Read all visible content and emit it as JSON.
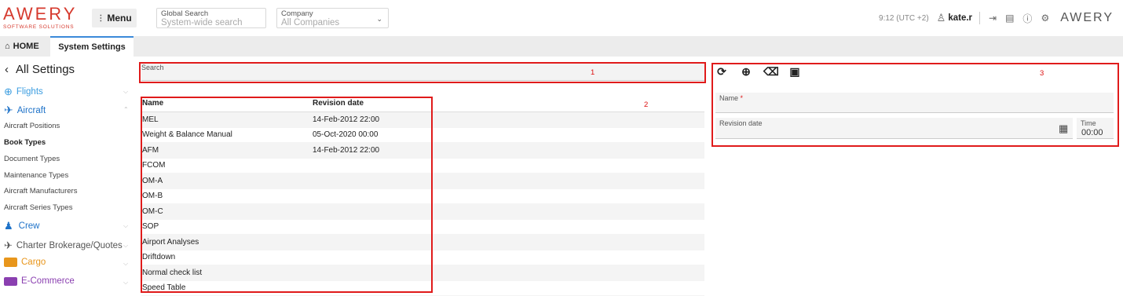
{
  "header": {
    "logo_main": "AWERY",
    "logo_sub": "SOFTWARE SOLUTIONS",
    "menu_label": "Menu",
    "global_search_label": "Global Search",
    "global_search_placeholder": "System-wide search",
    "company_label": "Company",
    "company_value": "All Companies",
    "time": "9:12 (UTC +2)",
    "user": "kate.r",
    "brand_right": "AWERY"
  },
  "tabs": {
    "home": "HOME",
    "system_settings": "System Settings"
  },
  "sidebar": {
    "back_label": "All Settings",
    "groups": {
      "flights": "Flights",
      "aircraft": "Aircraft",
      "crew": "Crew",
      "charter": "Charter Brokerage/Quotes",
      "cargo": "Cargo",
      "ecommerce": "E-Commerce"
    },
    "aircraft_items": [
      "Aircraft Positions",
      "Book Types",
      "Document Types",
      "Maintenance Types",
      "Aircraft Manufacturers",
      "Aircraft Series Types"
    ]
  },
  "search": {
    "label": "Search",
    "annotation": "1"
  },
  "table": {
    "annotation": "2",
    "columns": [
      "Name",
      "Revision date"
    ],
    "rows": [
      [
        "MEL",
        "14-Feb-2012 22:00"
      ],
      [
        "Weight & Balance Manual",
        "05-Oct-2020 00:00"
      ],
      [
        "AFM",
        "14-Feb-2012 22:00"
      ],
      [
        "FCOM",
        ""
      ],
      [
        "OM-A",
        ""
      ],
      [
        "OM-B",
        ""
      ],
      [
        "OM-C",
        ""
      ],
      [
        "SOP",
        ""
      ],
      [
        "Airport Analyses",
        ""
      ],
      [
        "Driftdown",
        ""
      ],
      [
        "Normal check list",
        ""
      ],
      [
        "Speed Table",
        ""
      ]
    ]
  },
  "form": {
    "annotation": "3",
    "name_label": "Name",
    "required_mark": "*",
    "revision_label": "Revision date",
    "time_label": "Time",
    "time_value": "00:00"
  },
  "colors": {
    "brand_red": "#d63a2e",
    "annotation_red": "#e01b1b",
    "flights": "#3b9de0",
    "aircraft": "#1e72c8",
    "crew": "#1e72c8",
    "charter": "#555555",
    "cargo": "#e8961c",
    "ecommerce": "#8a3fb0"
  }
}
